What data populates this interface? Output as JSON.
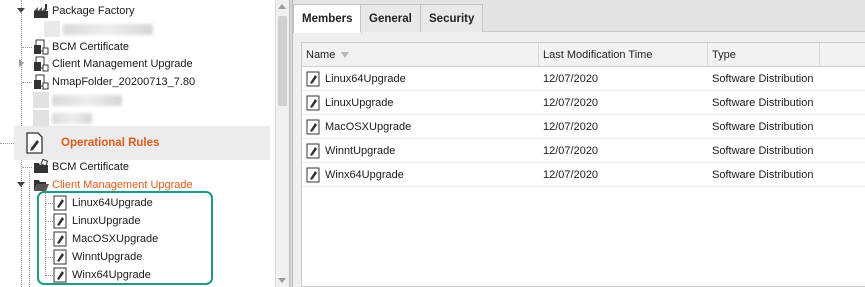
{
  "tree": {
    "package_factory": "Package Factory",
    "bcm_certificate": "BCM Certificate",
    "client_mgmt_upgrade": "Client Management Upgrade",
    "nmap_folder": "NmapFolder_20200713_7.80",
    "operational_rules": "Operational Rules",
    "op_bcm_certificate": "BCM Certificate",
    "op_client_mgmt_upgrade": "Client Management Upgrade",
    "rules": [
      "Linux64Upgrade",
      "LinuxUpgrade",
      "MacOSXUpgrade",
      "WinntUpgrade",
      "Winx64Upgrade"
    ]
  },
  "tabs": [
    "Members",
    "General",
    "Security"
  ],
  "grid": {
    "columns": [
      "Name",
      "Last Modification Time",
      "Type"
    ],
    "rows": [
      {
        "name": "Linux64Upgrade",
        "time": "12/07/2020",
        "type": "Software Distribution"
      },
      {
        "name": "LinuxUpgrade",
        "time": "12/07/2020",
        "type": "Software Distribution"
      },
      {
        "name": "MacOSXUpgrade",
        "time": "12/07/2020",
        "type": "Software Distribution"
      },
      {
        "name": "WinntUpgrade",
        "time": "12/07/2020",
        "type": "Software Distribution"
      },
      {
        "name": "Winx64Upgrade",
        "time": "12/07/2020",
        "type": "Software Distribution"
      }
    ]
  },
  "colors": {
    "accent": "#e05a1a",
    "highlight": "#1f9a8a"
  },
  "icons": {
    "package": "package-icon",
    "folder": "folder-icon",
    "rule": "rule-icon",
    "package_item": "package-item-icon"
  }
}
